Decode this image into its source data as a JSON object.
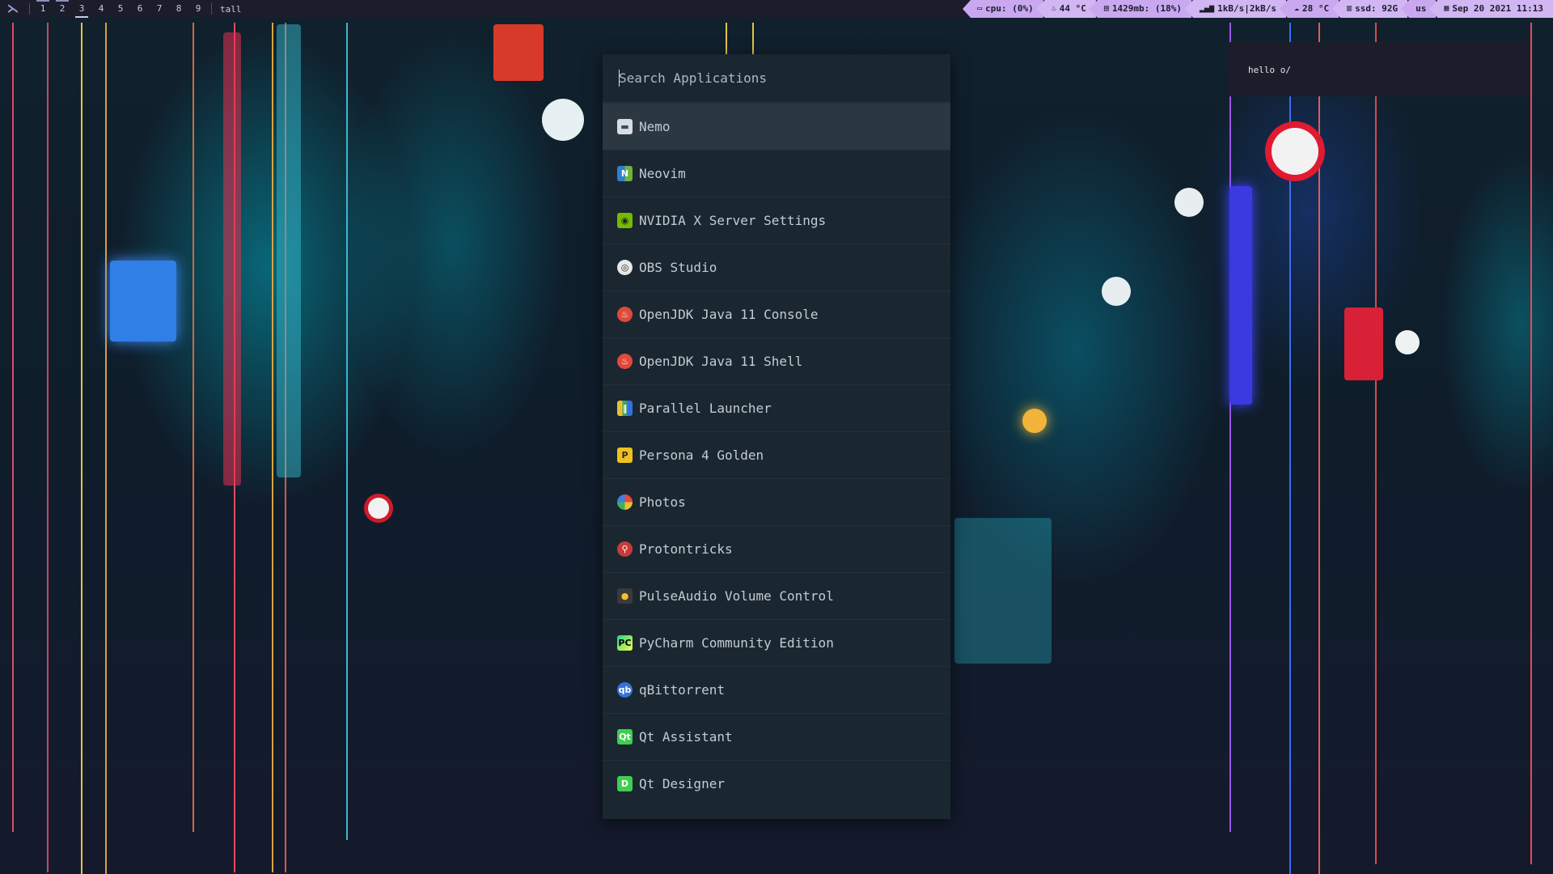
{
  "topbar": {
    "workspaces": [
      "1",
      "2",
      "3",
      "4",
      "5",
      "6",
      "7",
      "8",
      "9"
    ],
    "layout": "tall",
    "modules": {
      "cpu": "cpu: (0%)",
      "temp": "44 °C",
      "mem": "1429mb: (18%)",
      "net": "1kB/s|2kB/s",
      "weather": "28 °C",
      "ssd": "ssd: 92G",
      "keyboard": "us",
      "datetime": "Sep 20 2021 11:13"
    }
  },
  "launcher": {
    "search_placeholder": "Search Applications",
    "items": [
      {
        "label": "Nemo",
        "icon": "folder-icon"
      },
      {
        "label": "Neovim",
        "icon": "neovim-icon"
      },
      {
        "label": "NVIDIA X Server Settings",
        "icon": "nvidia-icon"
      },
      {
        "label": "OBS Studio",
        "icon": "obs-icon"
      },
      {
        "label": "OpenJDK Java 11 Console",
        "icon": "java-icon"
      },
      {
        "label": "OpenJDK Java 11 Shell",
        "icon": "java-icon"
      },
      {
        "label": "Parallel Launcher",
        "icon": "parallel-launcher-icon"
      },
      {
        "label": "Persona 4 Golden",
        "icon": "persona-icon"
      },
      {
        "label": "Photos",
        "icon": "photos-icon"
      },
      {
        "label": "Protontricks",
        "icon": "protontricks-icon"
      },
      {
        "label": "PulseAudio Volume Control",
        "icon": "speaker-icon"
      },
      {
        "label": "PyCharm Community Edition",
        "icon": "pycharm-icon"
      },
      {
        "label": "qBittorrent",
        "icon": "qbittorrent-icon"
      },
      {
        "label": "Qt Assistant",
        "icon": "qt-assistant-icon"
      },
      {
        "label": "Qt Designer",
        "icon": "qt-designer-icon"
      }
    ]
  },
  "notification": {
    "text": "hello o/"
  },
  "colors": {
    "bar_module": "#c9a8f0",
    "launcher_bg": "#1a2730",
    "selected_bg": "#2b3841"
  }
}
